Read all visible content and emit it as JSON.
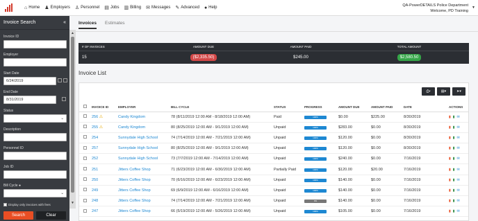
{
  "nav": {
    "items": [
      {
        "label": "Home",
        "icon": "home-icon",
        "glyph": "⌂"
      },
      {
        "label": "Employers",
        "icon": "users-icon",
        "glyph": "♟"
      },
      {
        "label": "Personnel",
        "icon": "user-icon",
        "glyph": "♙"
      },
      {
        "label": "Jobs",
        "icon": "briefcase-icon",
        "glyph": "▤"
      },
      {
        "label": "Billing",
        "icon": "billing-icon",
        "glyph": "▥"
      },
      {
        "label": "Messages",
        "icon": "envelope-icon",
        "glyph": "✉"
      },
      {
        "label": "Advanced",
        "icon": "wrench-icon",
        "glyph": "✎"
      },
      {
        "label": "Help",
        "icon": "help-icon",
        "glyph": "●"
      }
    ],
    "department": "QA-PowerDETAILS Police Department",
    "welcome": "Welcome, PD Training"
  },
  "sidebar": {
    "title": "Invoice Search",
    "collapse_glyph": "«",
    "fields": {
      "invoice_id": {
        "label": "Invoice ID",
        "value": ""
      },
      "employer": {
        "label": "Employer",
        "value": ""
      },
      "start_date": {
        "label": "Start Date",
        "value": "6/24/2019"
      },
      "end_date": {
        "label": "End Date",
        "value": "8/31/2019"
      },
      "status": {
        "label": "Status",
        "value": ""
      },
      "description": {
        "label": "Description",
        "value": ""
      },
      "personnel_id": {
        "label": "Personnel ID",
        "value": ""
      },
      "job_id": {
        "label": "Job ID",
        "value": ""
      },
      "bill_cycle": {
        "label": "Bill Cycle",
        "value": ""
      }
    },
    "display_only_fees": "Display only invoices with fees",
    "search_label": "Search",
    "clear_label": "Clear"
  },
  "tabs": {
    "invoices": "Invoices",
    "estimates": "Estimates"
  },
  "summary": {
    "headers": [
      "# OF INVOICES",
      "AMOUNT DUE",
      "AMOUNT PAID",
      "TOTAL AMOUNT"
    ],
    "count": "15",
    "amount_due": "($2,335.50)",
    "amount_paid": "$245.00",
    "total": "$2,580.50",
    "colors": {
      "due": "#d34747",
      "total": "#35a548"
    }
  },
  "list_title": "Invoice List",
  "columns": [
    "INVOICE ID",
    "EMPLOYER",
    "BILL CYCLE",
    "STATUS",
    "PROGRESS",
    "AMOUNT DUE",
    "AMOUNT PAID",
    "DATE",
    "ACTIONS"
  ],
  "rows": [
    {
      "id": "256",
      "warn": true,
      "employer": "Candy Kingdom",
      "cycle": "78 (8/11/2019 12:00 AM - 8/18/2019 12:00 AM)",
      "status": "Paid",
      "progress": "100%",
      "pcolor": "#1e88d2",
      "due": "$0.00",
      "paid": "$225.00",
      "date": "8/30/2019"
    },
    {
      "id": "255",
      "warn": true,
      "employer": "Candy Kingdom",
      "cycle": "80 (8/25/2019 12:00 AM - 9/1/2019 12:00 AM)",
      "status": "Unpaid",
      "progress": "100%",
      "pcolor": "#1e88d2",
      "due": "$283.00",
      "paid": "$0.00",
      "date": "8/30/2019"
    },
    {
      "id": "254",
      "warn": false,
      "employer": "Sunnydale High School",
      "cycle": "74 (7/14/2019 12:00 AM - 7/21/2019 12:00 AM)",
      "status": "Unpaid",
      "progress": "100%",
      "pcolor": "#1e88d2",
      "due": "$120.00",
      "paid": "$0.00",
      "date": "8/30/2019"
    },
    {
      "id": "257",
      "warn": false,
      "employer": "Sunnydale High School",
      "cycle": "80 (8/25/2019 12:00 AM - 9/1/2019 12:00 AM)",
      "status": "Unpaid",
      "progress": "100%",
      "pcolor": "#1e88d2",
      "due": "$120.00",
      "paid": "$0.00",
      "date": "8/30/2019"
    },
    {
      "id": "252",
      "warn": false,
      "employer": "Sunnydale High School",
      "cycle": "73 (7/7/2019 12:00 AM - 7/14/2019 12:00 AM)",
      "status": "Unpaid",
      "progress": "100%",
      "pcolor": "#1e88d2",
      "due": "$240.00",
      "paid": "$0.00",
      "date": "7/16/2019"
    },
    {
      "id": "251",
      "warn": false,
      "employer": "Jitters Coffee Shop",
      "cycle": "71 (6/23/2019 12:00 AM - 6/30/2019 12:00 AM)",
      "status": "Partially Paid",
      "progress": "100%",
      "pcolor": "#1e88d2",
      "due": "$120.00",
      "paid": "$20.00",
      "date": "7/16/2019"
    },
    {
      "id": "250",
      "warn": false,
      "employer": "Jitters Coffee Shop",
      "cycle": "70 (6/16/2019 12:00 AM - 6/23/2019 12:00 AM)",
      "status": "Unpaid",
      "progress": "100%",
      "pcolor": "#1e88d2",
      "due": "$140.00",
      "paid": "$0.00",
      "date": "7/16/2019"
    },
    {
      "id": "249",
      "warn": false,
      "employer": "Jitters Coffee Shop",
      "cycle": "69 (6/9/2019 12:00 AM - 6/16/2019 12:00 AM)",
      "status": "Unpaid",
      "progress": "100%",
      "pcolor": "#1e88d2",
      "due": "$140.00",
      "paid": "$0.00",
      "date": "7/16/2019"
    },
    {
      "id": "248",
      "warn": false,
      "employer": "Jitters Coffee Shop",
      "cycle": "74 (7/14/2019 12:00 AM - 7/21/2019 12:00 AM)",
      "status": "Unpaid",
      "progress": "0%",
      "pcolor": "#777777",
      "due": "$140.00",
      "paid": "$0.00",
      "date": "7/16/2019"
    },
    {
      "id": "247",
      "warn": false,
      "employer": "Jitters Coffee Shop",
      "cycle": "66 (5/19/2019 12:00 AM - 5/26/2019 12:00 AM)",
      "status": "Unpaid",
      "progress": "100%",
      "pcolor": "#1e88d2",
      "due": "$105.00",
      "paid": "$0.00",
      "date": "7/16/2019"
    }
  ]
}
